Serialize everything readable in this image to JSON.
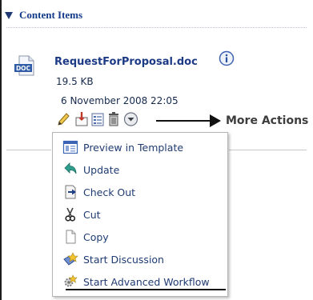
{
  "section": {
    "title": "Content Items"
  },
  "document": {
    "name": "RequestForProposal.doc",
    "size": "19.5 KB",
    "modified": "6 November 2008 22:05",
    "type_badge": "DOC"
  },
  "annotation": {
    "label": "More Actions"
  },
  "action_icons": [
    "pencil-icon",
    "download-icon",
    "properties-icon",
    "delete-icon",
    "more-actions-icon"
  ],
  "menu": {
    "items": [
      {
        "label": "Preview in Template",
        "icon": "template-icon"
      },
      {
        "label": "Update",
        "icon": "update-icon"
      },
      {
        "label": "Check Out",
        "icon": "check-out-icon"
      },
      {
        "label": "Cut",
        "icon": "scissors-icon"
      },
      {
        "label": "Copy",
        "icon": "copy-icon"
      },
      {
        "label": "Start Discussion",
        "icon": "discussion-icon"
      },
      {
        "label": "Start Advanced Workflow",
        "icon": "workflow-icon"
      }
    ]
  },
  "colors": {
    "link": "#1c3a86",
    "heading": "#123a8a",
    "menu_text": "#1f3b73",
    "menu_border": "#b5b5b5"
  }
}
